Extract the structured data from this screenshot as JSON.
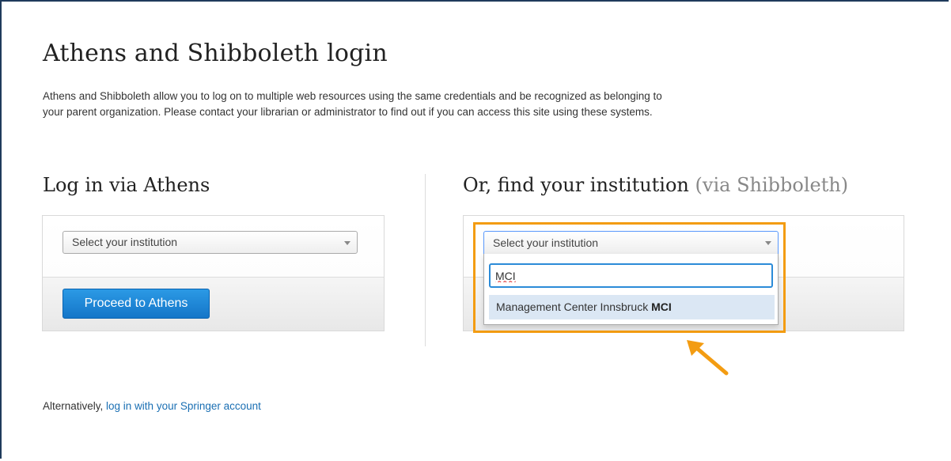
{
  "page": {
    "title": "Athens and Shibboleth login",
    "intro": "Athens and Shibboleth allow you to log on to multiple web resources using the same credentials and be recognized as belonging to your parent organization. Please contact your librarian or administrator to find out if you can access this site using these systems."
  },
  "athens": {
    "heading": "Log in via Athens",
    "select_value": "Select your institution",
    "button_label": "Proceed to Athens"
  },
  "shibboleth": {
    "heading": "Or, find your institution",
    "heading_suffix": "(via Shibboleth)",
    "select_value": "Select your institution",
    "search_value": "MCI",
    "result_prefix": "Management Center Innsbruck ",
    "result_match": "MCI"
  },
  "footer": {
    "prefix": "Alternatively, ",
    "link_label": "log in with your Springer account"
  },
  "annotation": {
    "highlight_color": "#f39c12",
    "arrow_color": "#f39c12",
    "arrow_icon": "arrow-up-left-icon"
  },
  "colors": {
    "primary_button": "#1a82d4",
    "link": "#1a6fb3",
    "focus_border": "#2b8bd8"
  }
}
